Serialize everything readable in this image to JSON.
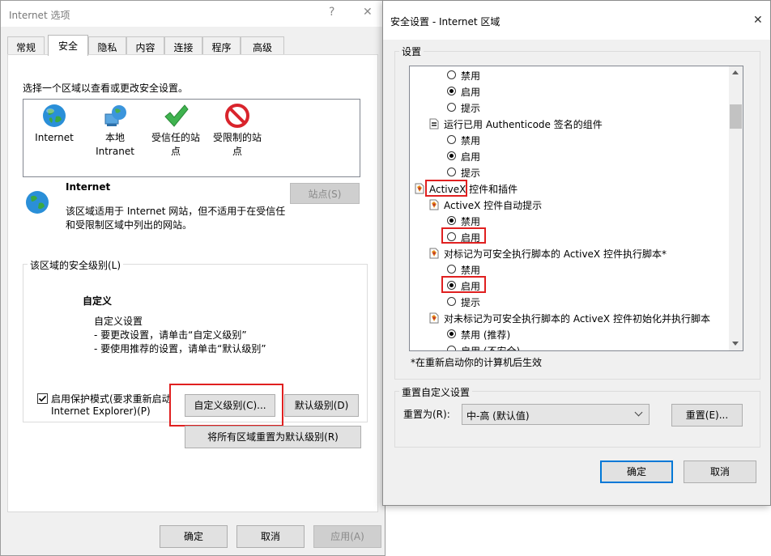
{
  "left": {
    "title": "Internet 选项",
    "help_glyph": "?",
    "close_glyph": "✕",
    "tabs": [
      "常规",
      "安全",
      "隐私",
      "内容",
      "连接",
      "程序",
      "高级"
    ],
    "select_zone_label": "选择一个区域以查看或更改安全设置。",
    "zones": [
      {
        "label": "Internet",
        "icon": "globe-icon"
      },
      {
        "label": "本地\nIntranet",
        "icon": "intranet-icon"
      },
      {
        "label": "受信任的站\n点",
        "icon": "checkmark-icon"
      },
      {
        "label": "受限制的站\n点",
        "icon": "restricted-icon"
      }
    ],
    "zone_title": "Internet",
    "zone_desc": "该区域适用于 Internet 网站，但不适用于在受信任\n和受限制区域中列出的网站。",
    "sites_button": "站点(S)",
    "security_level_group": "该区域的安全级别(L)",
    "custom_title": "自定义",
    "custom_text1": "自定义设置",
    "custom_text2": "- 要更改设置，请单击“自定义级别”",
    "custom_text3": "- 要使用推荐的设置，请单击“默认级别”",
    "protected_mode": "启用保护模式(要求重新启动",
    "protected_mode2": "Internet Explorer)(P)",
    "protected_checked": true,
    "custom_level_button": "自定义级别(C)...",
    "default_level_button": "默认级别(D)",
    "reset_all_button": "将所有区域重置为默认级别(R)",
    "ok": "确定",
    "cancel": "取消",
    "apply": "应用(A)"
  },
  "right": {
    "title": "安全设置 - Internet 区域",
    "close_glyph": "✕",
    "settings_label": "设置",
    "list": [
      {
        "kind": "radio",
        "text": "禁用",
        "on": false
      },
      {
        "kind": "radio",
        "text": "启用",
        "on": true
      },
      {
        "kind": "radio",
        "text": "提示",
        "on": false
      },
      {
        "kind": "header",
        "text": "运行已用 Authenticode 签名的组件",
        "icon": "settings-page-icon"
      },
      {
        "kind": "radio",
        "text": "禁用",
        "on": false
      },
      {
        "kind": "radio",
        "text": "启用",
        "on": true
      },
      {
        "kind": "radio",
        "text": "提示",
        "on": false
      },
      {
        "kind": "category",
        "text": "ActiveX 控件和插件",
        "icon": "activex-icon"
      },
      {
        "kind": "header",
        "text": "ActiveX 控件自动提示",
        "icon": "activex-icon"
      },
      {
        "kind": "radio",
        "text": "禁用",
        "on": true
      },
      {
        "kind": "radio",
        "text": "启用",
        "on": false
      },
      {
        "kind": "header",
        "text": "对标记为可安全执行脚本的 ActiveX 控件执行脚本*",
        "icon": "activex-icon"
      },
      {
        "kind": "radio",
        "text": "禁用",
        "on": false
      },
      {
        "kind": "radio",
        "text": "启用",
        "on": true
      },
      {
        "kind": "radio",
        "text": "提示",
        "on": false
      },
      {
        "kind": "header",
        "text": "对未标记为可安全执行脚本的 ActiveX 控件初始化并执行脚本",
        "icon": "activex-icon"
      },
      {
        "kind": "radio",
        "text": "禁用 (推荐)",
        "on": true
      },
      {
        "kind": "radio",
        "text": "启用 (不安全)",
        "on": false
      }
    ],
    "restart_note": "*在重新启动你的计算机后生效",
    "reset_group": "重置自定义设置",
    "reset_to_label": "重置为(R):",
    "reset_select_value": "中-高 (默认值)",
    "reset_button": "重置(E)...",
    "ok": "确定",
    "cancel": "取消"
  }
}
